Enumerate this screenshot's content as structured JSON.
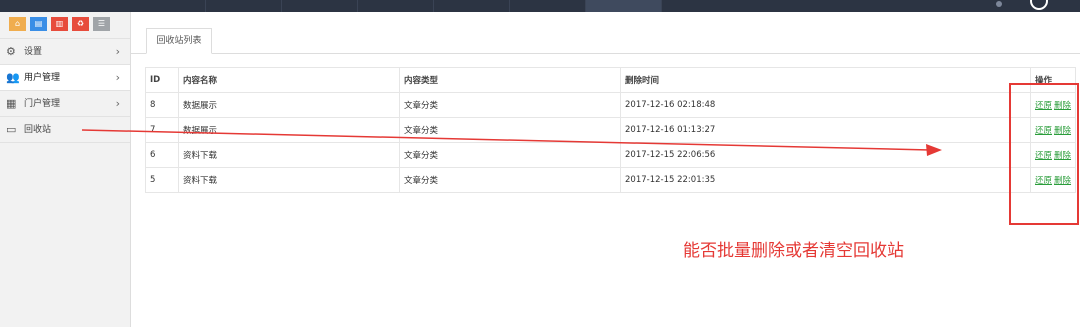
{
  "shortcuts": [
    {
      "icon": "home-icon",
      "color": "#f0ad4e"
    },
    {
      "icon": "document-icon",
      "color": "#3a8ee6"
    },
    {
      "icon": "trash-icon",
      "color": "#e74c3c"
    },
    {
      "icon": "recycle-icon",
      "color": "#e74c3c"
    },
    {
      "icon": "list-icon",
      "color": "#a0a4a8"
    }
  ],
  "sidebar": {
    "items": [
      {
        "label": "设置",
        "icon": "gears-icon",
        "has_arrow": true
      },
      {
        "label": "用户管理",
        "icon": "users-icon",
        "has_arrow": true,
        "active": true
      },
      {
        "label": "门户管理",
        "icon": "grid-icon",
        "has_arrow": true
      },
      {
        "label": "回收站",
        "icon": "monitor-icon",
        "has_arrow": false
      }
    ]
  },
  "tab": {
    "label": "回收站列表"
  },
  "table": {
    "headers": [
      "ID",
      "内容名称",
      "内容类型",
      "删除时间",
      "操作"
    ],
    "rows": [
      {
        "id": "8",
        "name": "数据展示",
        "type": "文章分类",
        "time": "2017-12-16 02:18:48"
      },
      {
        "id": "7",
        "name": "数据展示",
        "type": "文章分类",
        "time": "2017-12-16 01:13:27"
      },
      {
        "id": "6",
        "name": "资料下载",
        "type": "文章分类",
        "time": "2017-12-15 22:06:56"
      },
      {
        "id": "5",
        "name": "资料下载",
        "type": "文章分类",
        "time": "2017-12-15 22:01:35"
      }
    ],
    "restore_label": "还原",
    "delete_label": "删除"
  },
  "annotation": {
    "text": "能否批量删除或者清空回收站",
    "color": "#e53935"
  }
}
